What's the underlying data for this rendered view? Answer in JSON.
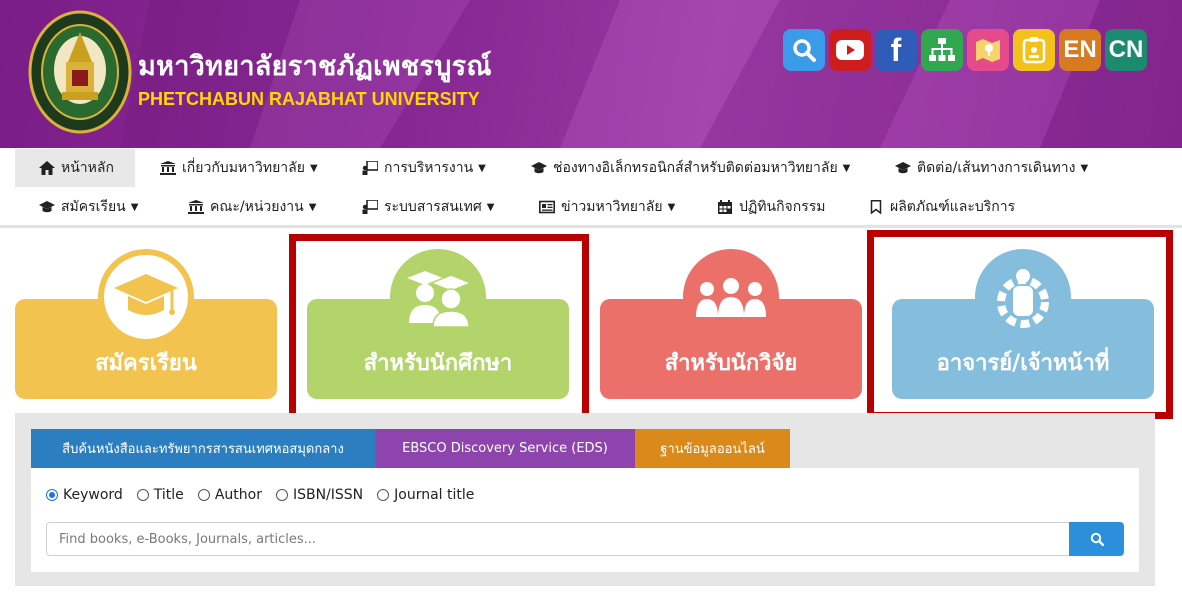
{
  "header": {
    "title_th": "มหาวิทยาลัยราชภัฏเพชรบูรณ์",
    "title_en": "PHETCHABUN RAJABHAT UNIVERSITY",
    "logo_text": "PHETCHABUN RAJABHAT UNIVERSITY",
    "top_icons": [
      {
        "name": "search-icon",
        "color": "#3a9be8"
      },
      {
        "name": "youtube-icon",
        "color": "#cf1d1d"
      },
      {
        "name": "facebook-icon",
        "color": "#2f5cb8"
      },
      {
        "name": "sitemap-icon",
        "color": "#2fa84f"
      },
      {
        "name": "map-icon",
        "color": "#e54b8a"
      },
      {
        "name": "calendar-badge-icon",
        "color": "#f2c21a"
      },
      {
        "name": "english-language-button",
        "label": "EN",
        "color": "#d87a1f"
      },
      {
        "name": "chinese-language-button",
        "label": "CN",
        "color": "#1c8a6e"
      }
    ]
  },
  "nav": {
    "row1": [
      {
        "label": "หน้าหลัก",
        "icon": "home-icon",
        "caret": false
      },
      {
        "label": "เกี่ยวกับมหาวิทยาลัย",
        "icon": "university-icon",
        "caret": true
      },
      {
        "label": "การบริหารงาน",
        "icon": "chalkboard-icon",
        "caret": true
      },
      {
        "label": "ช่องทางอิเล็กทรอนิกส์สำหรับติดต่อมหาวิทยาลัย",
        "icon": "graduation-cap-icon",
        "caret": true
      },
      {
        "label": "ติดต่อ/เส้นทางการเดินทาง",
        "icon": "graduation-cap-icon",
        "caret": true
      }
    ],
    "row2": [
      {
        "label": "สมัครเรียน",
        "icon": "graduation-cap-icon",
        "caret": true
      },
      {
        "label": "คณะ/หน่วยงาน",
        "icon": "university-icon",
        "caret": true
      },
      {
        "label": "ระบบสารสนเทศ",
        "icon": "chalkboard-icon",
        "caret": true
      },
      {
        "label": "ข่าวมหาวิทยาลัย",
        "icon": "newspaper-icon",
        "caret": true
      },
      {
        "label": "ปฏิทินกิจกรรม",
        "icon": "calendar-icon",
        "caret": false
      },
      {
        "label": "ผลิตภัณฑ์และบริการ",
        "icon": "bookmark-icon",
        "caret": false
      }
    ]
  },
  "cards": [
    {
      "label": "สมัครเรียน",
      "color": "#f2c44f",
      "icon": "graduation-cap-icon"
    },
    {
      "label": "สำหรับนักศึกษา",
      "color": "#b3d46a",
      "icon": "students-icon"
    },
    {
      "label": "สำหรับนักวิจัย",
      "color": "#ea7069",
      "icon": "researchers-icon"
    },
    {
      "label": "อาจารย์/เจ้าหน้าที่",
      "color": "#85bedc",
      "icon": "staff-gear-icon"
    }
  ],
  "search": {
    "tabs": [
      {
        "label": "สืบค้นหนังสือและทรัพยากรสารสนเทศหอสมุดกลาง",
        "color": "#2b7fc0"
      },
      {
        "label": "EBSCO Discovery Service (EDS)",
        "color": "#8e44ad"
      },
      {
        "label": "ฐานข้อมูลออนไลน์",
        "color": "#d98a1a"
      }
    ],
    "radios": [
      {
        "label": "Keyword",
        "checked": true
      },
      {
        "label": "Title",
        "checked": false
      },
      {
        "label": "Author",
        "checked": false
      },
      {
        "label": "ISBN/ISSN",
        "checked": false
      },
      {
        "label": "Journal title",
        "checked": false
      }
    ],
    "placeholder": "Find books, e-Books, Journals, articles..."
  }
}
